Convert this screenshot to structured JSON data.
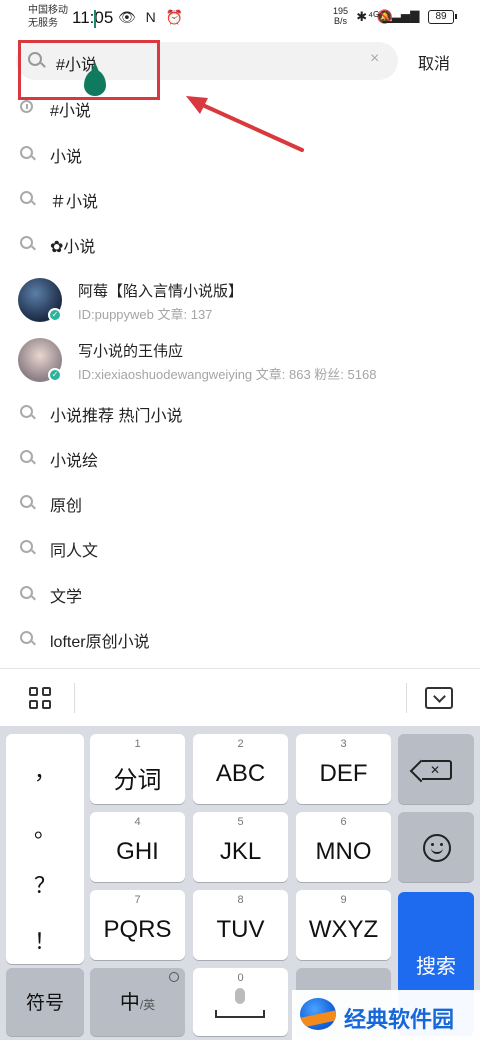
{
  "status_bar": {
    "carrier_line1": "中国移动",
    "carrier_line2": "无服务",
    "time": "11:05",
    "left_icons": "👁 N ⏰",
    "right_icons": "✱ 🔕",
    "net_speed_value": "195",
    "net_speed_unit": "B/s",
    "signal_icons": "⁴ᴳ ▁▃▅▇",
    "battery": "89"
  },
  "search": {
    "query": "#小说",
    "cancel_label": "取消",
    "clear_glyph": "×"
  },
  "suggestions_top": [
    {
      "text": "#小说",
      "kind": "history"
    },
    {
      "text": "小说",
      "kind": "search"
    },
    {
      "text": "＃小说",
      "kind": "search"
    },
    {
      "text": "✿小说",
      "kind": "search"
    }
  ],
  "users": [
    {
      "name": "阿莓【陷入言情小说版】",
      "meta": "ID:puppyweb    文章: 137"
    },
    {
      "name": "写小说的王伟应",
      "meta": "ID:xiexiaoshuodewangweiying    文章: 863    粉丝: 5168"
    }
  ],
  "suggestions_bottom": [
    {
      "text": "小说推荐 热门小说"
    },
    {
      "text": "小说绘"
    },
    {
      "text": "原创"
    },
    {
      "text": "同人文"
    },
    {
      "text": "文学"
    },
    {
      "text": "lofter原创小说"
    }
  ],
  "keyboard": {
    "punctuation": [
      "，",
      "。",
      "？",
      "！"
    ],
    "keys": [
      {
        "num": "1",
        "label": "分词"
      },
      {
        "num": "2",
        "label": "ABC"
      },
      {
        "num": "3",
        "label": "DEF"
      },
      {
        "num": "4",
        "label": "GHI"
      },
      {
        "num": "5",
        "label": "JKL"
      },
      {
        "num": "6",
        "label": "MNO"
      },
      {
        "num": "7",
        "label": "PQRS"
      },
      {
        "num": "8",
        "label": "TUV"
      },
      {
        "num": "9",
        "label": "WXYZ"
      }
    ],
    "symbol_label": "符号",
    "lang_main": "中",
    "lang_alt": "/英",
    "zero_label": "0",
    "search_label": "搜索"
  },
  "watermark": {
    "text": "经典软件园"
  },
  "colors": {
    "accent": "#1e6bf0",
    "annotation": "#d9383e",
    "verified": "#2bb39b"
  }
}
